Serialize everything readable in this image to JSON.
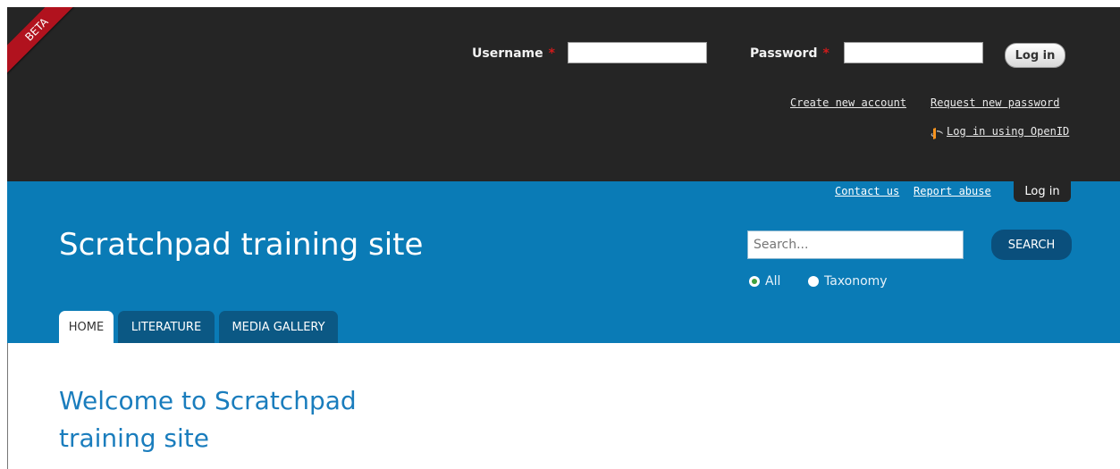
{
  "beta_label": "BETA",
  "login": {
    "username_label": "Username",
    "password_label": "Password",
    "required_mark": "*",
    "username_value": "",
    "password_value": "",
    "submit_label": "Log in",
    "create_account": "Create new account",
    "request_password": "Request new password",
    "openid_link": "Log in using OpenID"
  },
  "utility_links": {
    "contact": "Contact us",
    "report": "Report abuse",
    "login_tab": "Log in"
  },
  "site": {
    "title": "Scratchpad training site"
  },
  "search": {
    "placeholder": "Search...",
    "button_label": "SEARCH",
    "options": [
      {
        "label": "All",
        "checked": true
      },
      {
        "label": "Taxonomy",
        "checked": false
      }
    ]
  },
  "tabs": [
    {
      "label": "HOME",
      "active": true
    },
    {
      "label": "LITERATURE",
      "active": false
    },
    {
      "label": "MEDIA GALLERY",
      "active": false
    }
  ],
  "main": {
    "heading": "Welcome to Scratchpad training site"
  },
  "colors": {
    "top_bar": "#252525",
    "header_blue": "#0a7bb6",
    "tab_dark_blue": "#0b5884",
    "beta_ribbon": "#b1121e",
    "heading_blue": "#1a7dbd"
  }
}
